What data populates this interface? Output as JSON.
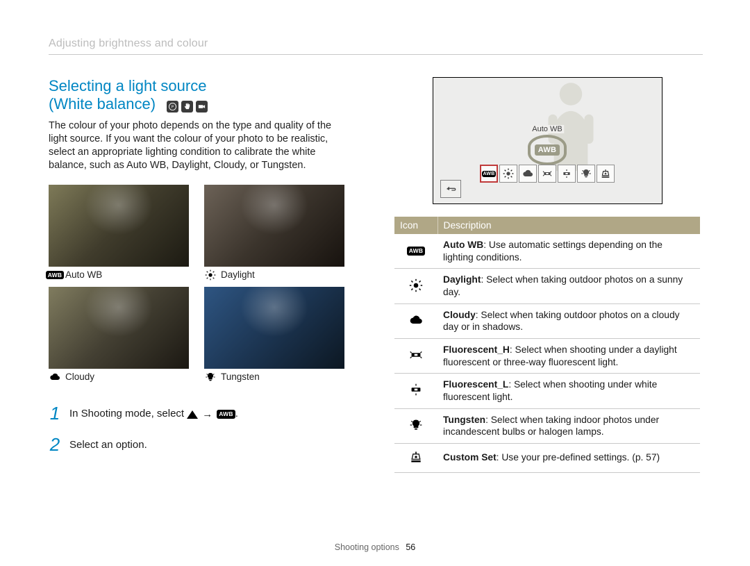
{
  "breadcrumb": "Adjusting brightness and colour",
  "section_title_line1": "Selecting a light source",
  "section_title_line2": "(White balance)",
  "intro": "The colour of your photo depends on the type and quality of the light source. If you want the colour of your photo to be realistic, select an appropriate lighting condition to calibrate the white balance, such as Auto WB, Daylight, Cloudy, or Tungsten.",
  "samples": [
    {
      "label": "Auto WB",
      "icon": "awb-chip-icon"
    },
    {
      "label": "Daylight",
      "icon": "sun-icon"
    },
    {
      "label": "Cloudy",
      "icon": "cloud-icon"
    },
    {
      "label": "Tungsten",
      "icon": "bulb-icon"
    }
  ],
  "steps": [
    {
      "num": "1",
      "text_before": "In Shooting mode, select ",
      "seq": [
        "triangle-up",
        "arrow-right",
        "awb-chip"
      ],
      "text_after": "."
    },
    {
      "num": "2",
      "text_before": "Select an option.",
      "seq": [],
      "text_after": ""
    }
  ],
  "screen": {
    "selected_label": "Auto WB",
    "badge_text": "AWB",
    "tiles": [
      "awb",
      "sun",
      "cloud",
      "fluor-h",
      "fluor-l",
      "bulb",
      "custom"
    ],
    "selected_index": 0
  },
  "table": {
    "head_icon": "Icon",
    "head_desc": "Description",
    "rows": [
      {
        "icon": "awb-chip-icon",
        "term": "Auto WB",
        "desc": ": Use automatic settings depending on the lighting conditions."
      },
      {
        "icon": "sun-icon",
        "term": "Daylight",
        "desc": ": Select when taking outdoor photos on a sunny day."
      },
      {
        "icon": "cloud-icon",
        "term": "Cloudy",
        "desc": ": Select when taking outdoor photos on a cloudy day or in shadows."
      },
      {
        "icon": "fluor-h-icon",
        "term": "Fluorescent_H",
        "desc": ": Select when shooting under a daylight fluorescent or three-way fluorescent light."
      },
      {
        "icon": "fluor-l-icon",
        "term": "Fluorescent_L",
        "desc": ": Select when shooting under white fluorescent light."
      },
      {
        "icon": "bulb-icon",
        "term": "Tungsten",
        "desc": ": Select when taking indoor photos under incandescent bulbs or halogen lamps."
      },
      {
        "icon": "custom-icon",
        "term": "Custom Set",
        "desc": ": Use your pre-defined settings. (p. 57)"
      }
    ]
  },
  "footer_label": "Shooting options",
  "footer_page": "56"
}
